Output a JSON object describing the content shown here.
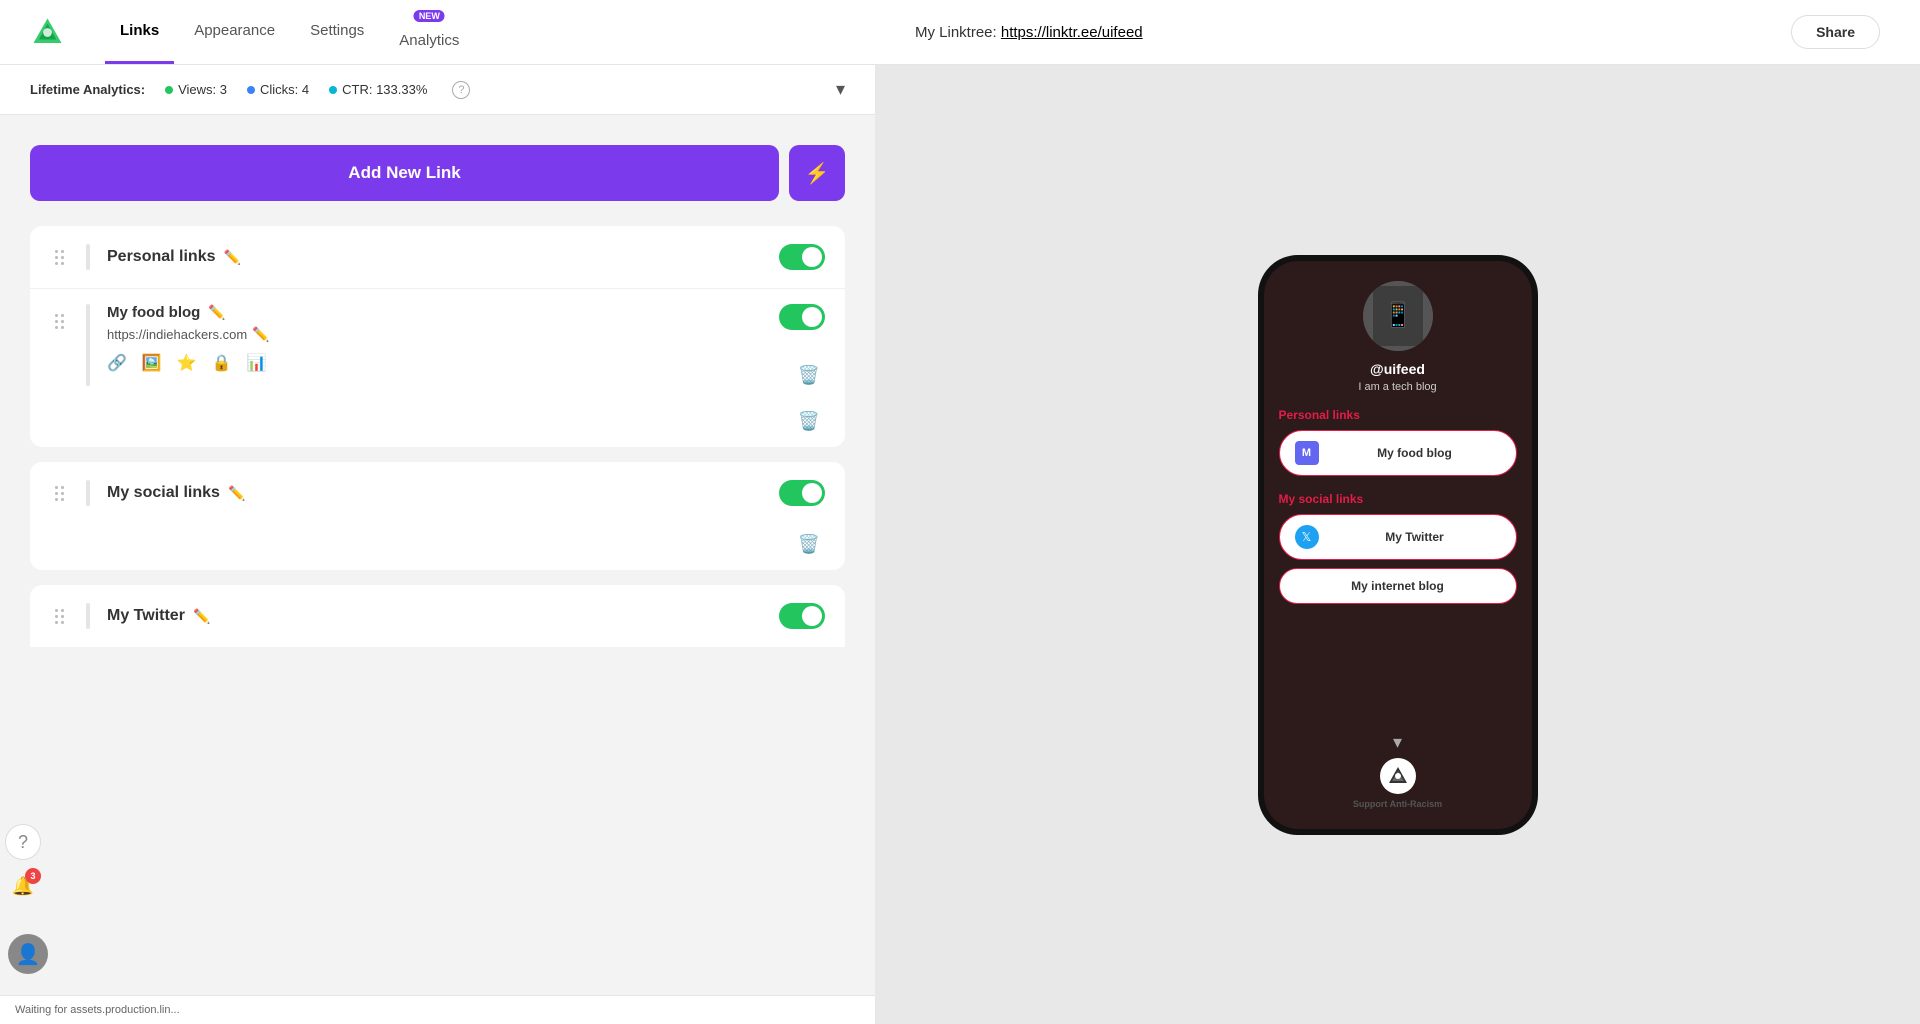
{
  "header": {
    "tabs": [
      {
        "id": "links",
        "label": "Links",
        "active": true,
        "badge": null
      },
      {
        "id": "appearance",
        "label": "Appearance",
        "active": false,
        "badge": null
      },
      {
        "id": "settings",
        "label": "Settings",
        "active": false,
        "badge": null
      },
      {
        "id": "analytics",
        "label": "Analytics",
        "active": false,
        "badge": "NEW"
      }
    ]
  },
  "analytics": {
    "label": "Lifetime Analytics:",
    "views_label": "Views: 3",
    "clicks_label": "Clicks: 4",
    "ctr_label": "CTR: 133.33%"
  },
  "toolbar": {
    "add_link_label": "Add New Link",
    "lightning_icon": "⚡"
  },
  "groups": [
    {
      "id": "personal-links",
      "title": "Personal links",
      "enabled": true,
      "links": [
        {
          "id": "my-food-blog",
          "title": "My food blog",
          "url": "https://indiehackers.com",
          "enabled": true
        }
      ]
    },
    {
      "id": "my-social-links",
      "title": "My social links",
      "enabled": true,
      "links": []
    },
    {
      "id": "my-twitter-partial",
      "title": "My Twitter",
      "enabled": true,
      "partial": true
    }
  ],
  "right_panel": {
    "linktree_label": "My Linktree:",
    "linktree_url": "https://linktr.ee/uifeed",
    "share_label": "Share"
  },
  "phone_preview": {
    "username": "@uifeed",
    "bio": "I am a tech blog",
    "section_personal": "Personal links",
    "section_social": "My social links",
    "food_blog_label": "My food blog",
    "twitter_label": "My Twitter",
    "internet_blog_label": "My internet blog",
    "bottom_label": "Support Anti-Racism"
  },
  "status_bar": {
    "text": "Waiting for assets.production.lin..."
  },
  "sidebar": {
    "notification_count": "3",
    "chat_icon": "?",
    "bell_icon": "🔔"
  }
}
